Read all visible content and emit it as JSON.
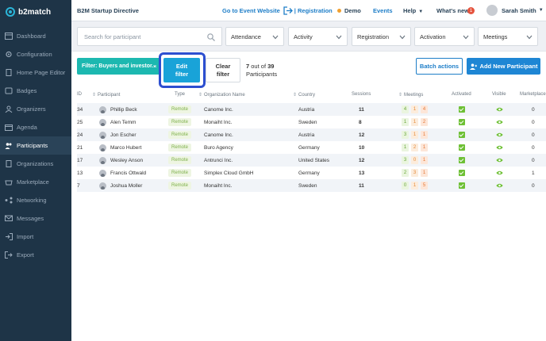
{
  "brand": {
    "name": "b2match"
  },
  "sidebar": {
    "items": [
      {
        "label": "Dashboard",
        "icon": "dashboard-icon"
      },
      {
        "label": "Configuration",
        "icon": "gear-icon"
      },
      {
        "label": "Home Page Editor",
        "icon": "file-icon"
      },
      {
        "label": "Badges",
        "icon": "badge-icon"
      },
      {
        "label": "Organizers",
        "icon": "organizers-icon"
      },
      {
        "label": "Agenda",
        "icon": "calendar-icon"
      },
      {
        "label": "Participants",
        "icon": "participants-icon",
        "active": true
      },
      {
        "label": "Organizations",
        "icon": "building-icon"
      },
      {
        "label": "Marketplace",
        "icon": "marketplace-icon"
      },
      {
        "label": "Networking",
        "icon": "networking-icon"
      },
      {
        "label": "Messages",
        "icon": "messages-icon"
      },
      {
        "label": "Import",
        "icon": "import-icon"
      },
      {
        "label": "Export",
        "icon": "export-icon"
      }
    ]
  },
  "topbar": {
    "event_title": "B2M Startup Directive",
    "go_to_site": "Go to Event Website",
    "registration": "| Registration",
    "demo": "Demo",
    "events": "Events",
    "help": "Help",
    "whats_new": "What's new",
    "whats_new_count": "1",
    "user": "Sarah Smith"
  },
  "filters": {
    "search_placeholder": "Search for participant",
    "dropdowns": [
      "Attendance",
      "Activity",
      "Registration",
      "Activation",
      "Meetings"
    ]
  },
  "actions": {
    "filter_pill": "Filter: Buyers and investor...",
    "edit_filter": [
      "Edit",
      "filter"
    ],
    "clear_filter": [
      "Clear",
      "filter"
    ],
    "count_shown": "7",
    "count_of": "out of",
    "count_total": "39",
    "count_label": "Participants",
    "batch": "Batch actions",
    "add": "Add New Participant"
  },
  "table": {
    "headers": [
      "ID",
      "Participant",
      "Type",
      "Organization Name",
      "Country",
      "Sessions",
      "Meetings",
      "Activated",
      "Visible",
      "Marketplace"
    ],
    "rows": [
      {
        "id": "34",
        "name": "Phillip Beck",
        "type": "Remote",
        "org": "Canome Inc.",
        "country": "Austria",
        "sessions": "11",
        "meetings": [
          "4",
          "1",
          "4"
        ],
        "marketplace": "0"
      },
      {
        "id": "25",
        "name": "Alen Temm",
        "type": "Remote",
        "org": "Monaiht Inc.",
        "country": "Sweden",
        "sessions": "8",
        "meetings": [
          "1",
          "1",
          "2"
        ],
        "marketplace": "0"
      },
      {
        "id": "24",
        "name": "Jon Escher",
        "type": "Remote",
        "org": "Canome Inc.",
        "country": "Austria",
        "sessions": "12",
        "meetings": [
          "3",
          "1",
          "1"
        ],
        "marketplace": "0"
      },
      {
        "id": "21",
        "name": "Marco Hubert",
        "type": "Remote",
        "org": "Buro Agency",
        "country": "Germany",
        "sessions": "10",
        "meetings": [
          "1",
          "2",
          "1"
        ],
        "marketplace": "0"
      },
      {
        "id": "17",
        "name": "Wesley Anson",
        "type": "Remote",
        "org": "Antrunci Inc.",
        "country": "United States",
        "sessions": "12",
        "meetings": [
          "3",
          "0",
          "1"
        ],
        "marketplace": "0"
      },
      {
        "id": "13",
        "name": "Francis Ottwald",
        "type": "Remote",
        "org": "Simplex Cloud GmbH",
        "country": "Germany",
        "sessions": "13",
        "meetings": [
          "2",
          "3",
          "1"
        ],
        "marketplace": "1"
      },
      {
        "id": "7",
        "name": "Joshua Moller",
        "type": "Remote",
        "org": "Monaiht Inc.",
        "country": "Sweden",
        "sessions": "11",
        "meetings": [
          "0",
          "1",
          "5"
        ],
        "marketplace": "0"
      }
    ]
  },
  "colors": {
    "sidebar": "#1e3447",
    "accent": "#1e86d4",
    "teal": "#1cb8b0",
    "highlight": "#2d4fd0"
  }
}
